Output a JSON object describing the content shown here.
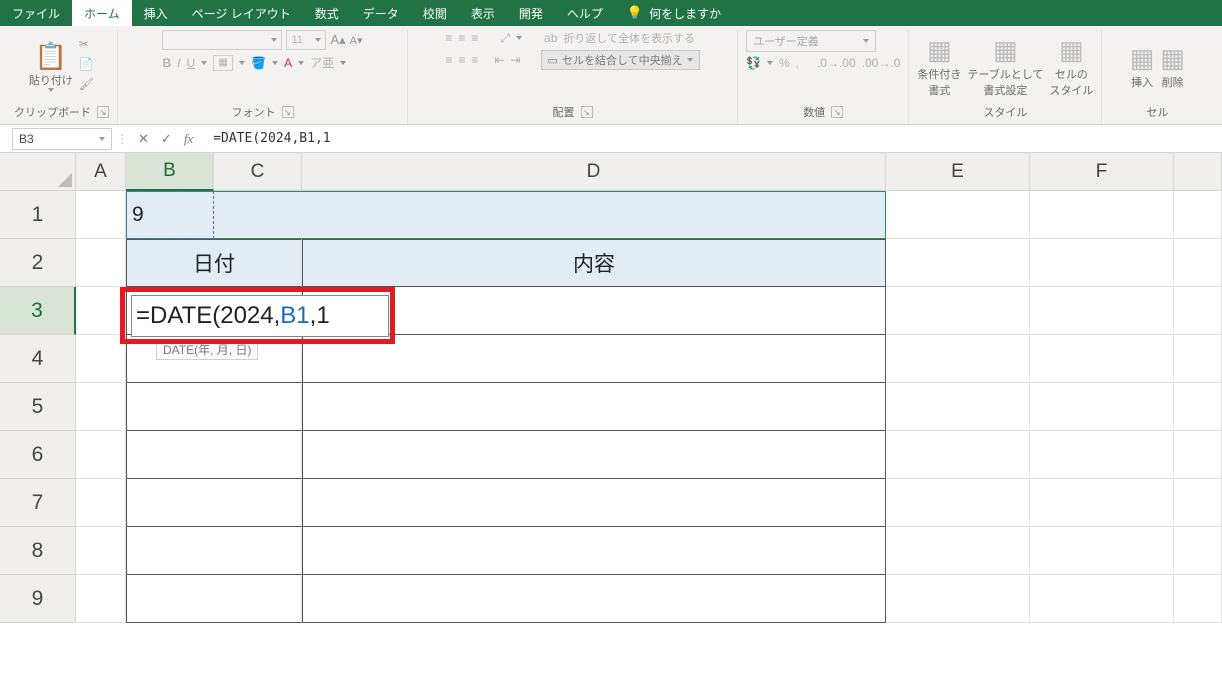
{
  "tabs": {
    "file": "ファイル",
    "home": "ホーム",
    "insert": "挿入",
    "layout": "ページ レイアウト",
    "formulas": "数式",
    "data": "データ",
    "review": "校閲",
    "view": "表示",
    "developer": "開発",
    "help": "ヘルプ",
    "tellme": "何をしますか"
  },
  "ribbon": {
    "clipboard": {
      "paste": "貼り付け",
      "label": "クリップボード"
    },
    "font": {
      "name_placeholder": "",
      "size": "11",
      "label": "フォント",
      "bold": "B",
      "italic": "I",
      "underline": "U"
    },
    "alignment": {
      "label": "配置",
      "wrap": "折り返して全体を表示する",
      "merge": "セルを結合して中央揃え"
    },
    "number": {
      "label": "数値",
      "format": "ユーザー定義"
    },
    "styles": {
      "label": "スタイル",
      "condfmt": "条件付き\n書式",
      "tablefmt": "テーブルとして\n書式設定",
      "cellstyle": "セルの\nスタイル"
    },
    "cells": {
      "label": "セル",
      "insert": "挿入",
      "delete": "削除"
    }
  },
  "nameBox": "B3",
  "formulaBar": "=DATE(2024,B1,1",
  "columns": [
    "A",
    "B",
    "C",
    "D",
    "E",
    "F"
  ],
  "rows": [
    "1",
    "2",
    "3",
    "4",
    "5",
    "6",
    "7",
    "8",
    "9"
  ],
  "cells": {
    "B1": "9",
    "B2": "日付",
    "D2": "内容"
  },
  "editing": {
    "prefix": "=DATE(2024,",
    "ref": "B1",
    "suffix": ",1",
    "hint": "DATE(年, 月, 日)"
  }
}
